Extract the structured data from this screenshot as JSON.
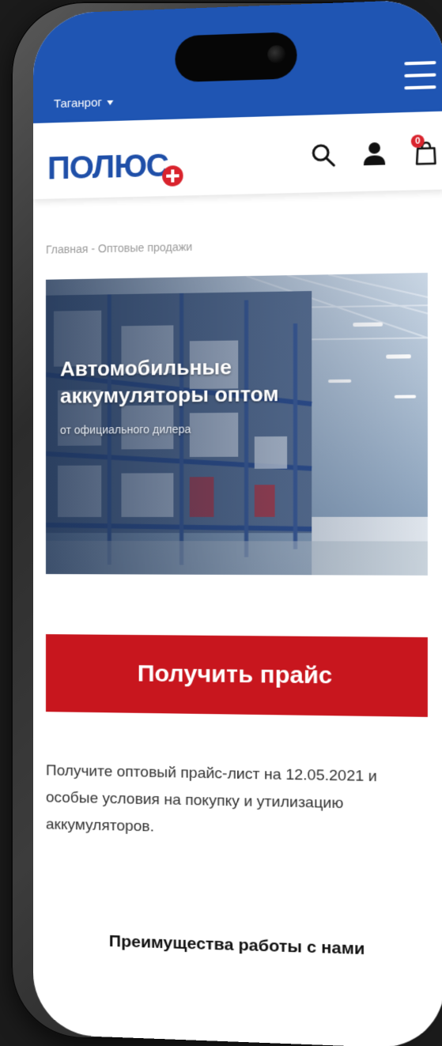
{
  "colors": {
    "brand_blue": "#1f55b3",
    "accent_red": "#c8161e",
    "text_dark": "#333333",
    "text_muted": "#9a9a9a"
  },
  "top_bar": {
    "city": "Таганрог",
    "city_icon": "caret-down-icon",
    "menu_icon": "hamburger-menu-icon"
  },
  "header": {
    "logo_text": "ПОЛЮС",
    "logo_icon": "red-cross-plus-icon",
    "icons": [
      "search-icon",
      "user-icon",
      "cart-icon"
    ],
    "cart_count": "0"
  },
  "breadcrumb": {
    "home": "Главная",
    "separator": " - ",
    "current": "Оптовые продажи"
  },
  "banner": {
    "title": "Автомобильные аккумуляторы оптом",
    "subtitle": "от официального дилера"
  },
  "cta": {
    "label": "Получить прайс"
  },
  "description": {
    "text": "Получите оптовый прайс-лист на 12.05.2021 и особые условия на покупку и утилизацию аккумуляторов."
  },
  "advantages": {
    "heading": "Преимущества работы с нами"
  }
}
